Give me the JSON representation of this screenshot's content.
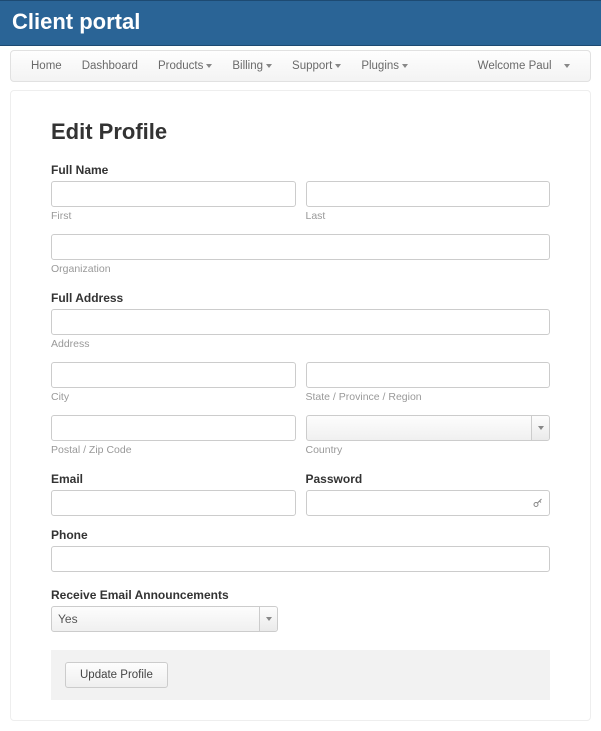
{
  "banner": {
    "title": "Client portal"
  },
  "nav": {
    "items": [
      {
        "label": "Home",
        "dropdown": false
      },
      {
        "label": "Dashboard",
        "dropdown": false
      },
      {
        "label": "Products",
        "dropdown": true
      },
      {
        "label": "Billing",
        "dropdown": true
      },
      {
        "label": "Support",
        "dropdown": true
      },
      {
        "label": "Plugins",
        "dropdown": true
      }
    ],
    "welcome": "Welcome Paul"
  },
  "page": {
    "title": "Edit Profile",
    "fullname_label": "Full Name",
    "first_sub": "First",
    "last_sub": "Last",
    "org_sub": "Organization",
    "address_label": "Full Address",
    "address_sub": "Address",
    "city_sub": "City",
    "state_sub": "State / Province / Region",
    "postal_sub": "Postal / Zip Code",
    "country_sub": "Country",
    "email_label": "Email",
    "password_label": "Password",
    "phone_label": "Phone",
    "announce_label": "Receive Email Announcements",
    "announce_value": "Yes",
    "submit_label": "Update Profile"
  },
  "values": {
    "first": "",
    "last": "",
    "org": "",
    "address": "",
    "city": "",
    "state": "",
    "postal": "",
    "country": "",
    "email": "",
    "password": "",
    "phone": ""
  }
}
